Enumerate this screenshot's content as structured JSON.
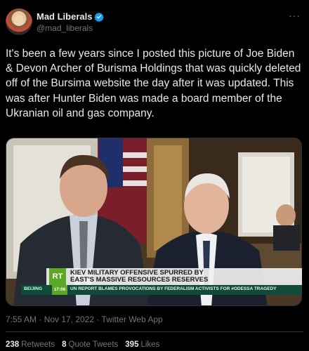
{
  "author": {
    "display_name": "Mad Liberals",
    "handle": "@mad_liberals",
    "verified_icon": "verified-badge-icon"
  },
  "menu": {
    "more_label": "···"
  },
  "tweet": {
    "text": "It's been a few years since I posted this picture of Joe Biden & Devon Archer of Burisma Holdings that was quickly deleted off of the Bursima website the day after it was updated.  This was after Hunter Biden was made a board member of the Ukranian oil and gas company."
  },
  "media": {
    "logo": "RT",
    "headline_line1": "KIEV MILITARY OFFENSIVE SPURRED BY",
    "headline_line2": "EAST'S MASSIVE RESOURCES RESERVES",
    "sub_label": "BEIJING",
    "sub_time": "17:06",
    "sub_text": "UN REPORT BLAMES PROVOCATIONS BY FEDERALISM ACTIVISTS FOR #ODESSA TRAGEDY"
  },
  "meta": {
    "timestamp": "7:55 AM · Nov 17, 2022 · Twitter Web App"
  },
  "stats": {
    "retweets_count": "238",
    "retweets_label": "Retweets",
    "quotes_count": "8",
    "quotes_label": "Quote Tweets",
    "likes_count": "395",
    "likes_label": "Likes"
  },
  "colors": {
    "background": "#000000",
    "text": "#e7e9ea",
    "secondary": "#71767b",
    "verified": "#1d9bf0",
    "rt_green": "#5aa826"
  }
}
